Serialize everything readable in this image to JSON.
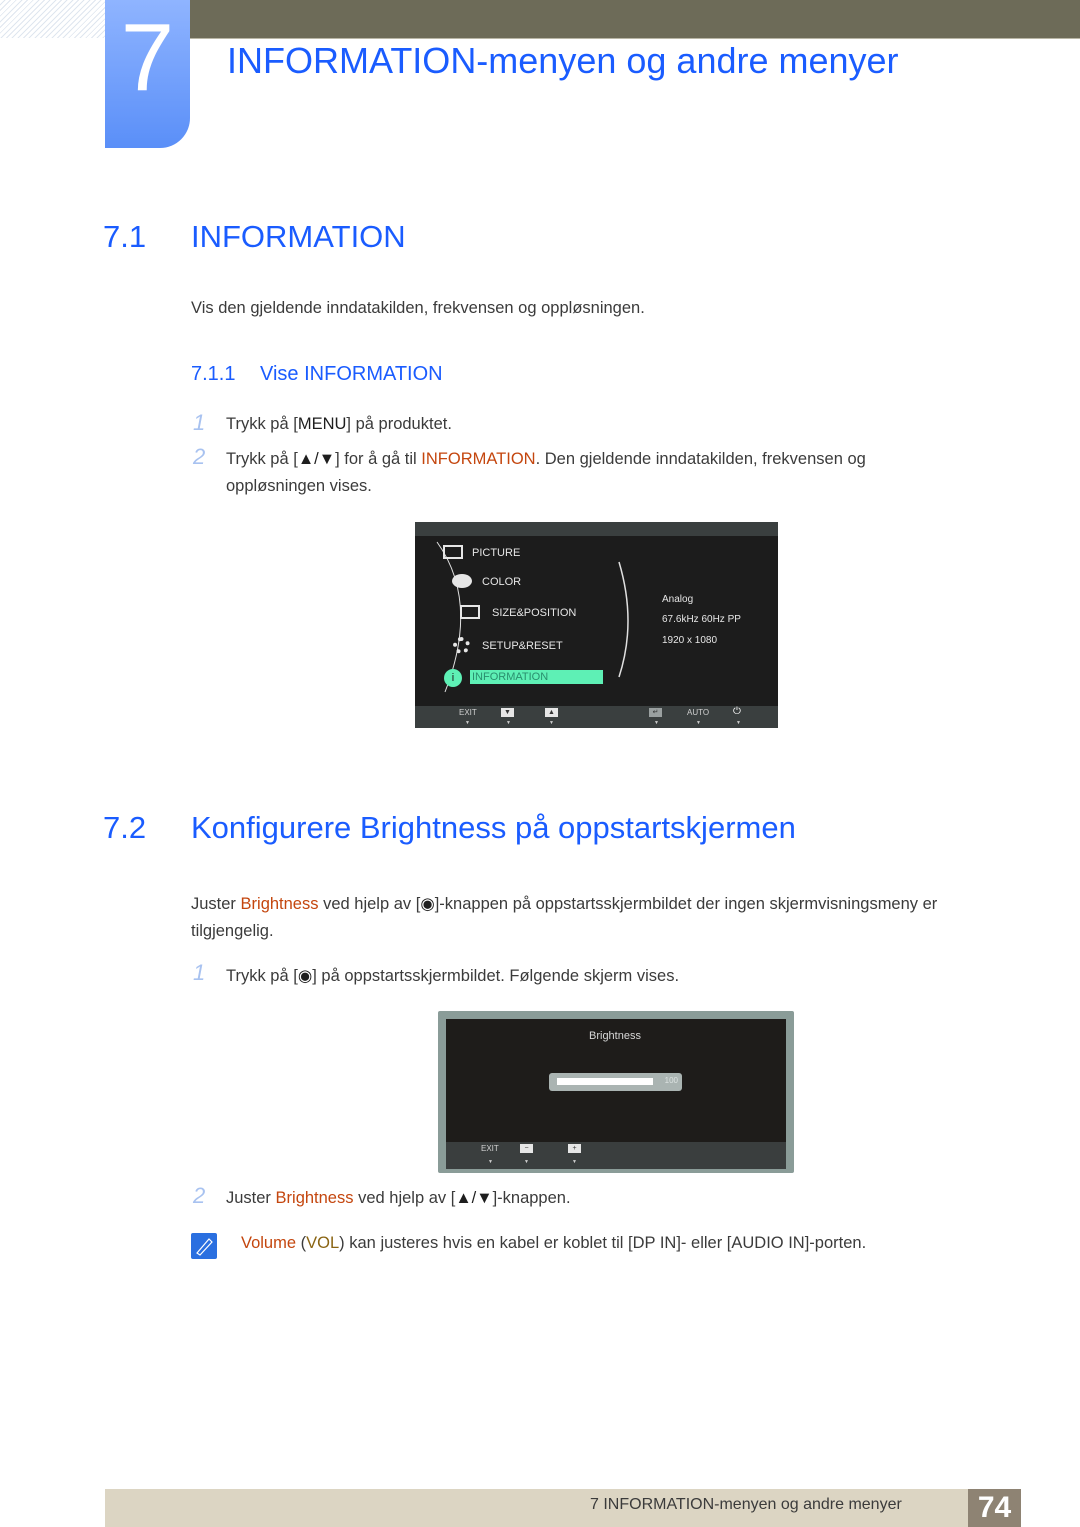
{
  "chapter": {
    "number": "7",
    "title": "INFORMATION-menyen og andre menyer"
  },
  "section_7_1": {
    "number": "7.1",
    "title": "INFORMATION",
    "intro": "Vis den gjeldende inndatakilden, frekvensen og oppløsningen.",
    "subsection": {
      "number": "7.1.1",
      "title": "Vise INFORMATION"
    },
    "steps": [
      {
        "num": "1",
        "pre": "Trykk på [",
        "key": "MENU",
        "post": "] på produktet."
      },
      {
        "num": "2",
        "pre": "Trykk på [",
        "key": "▲/▼",
        "mid": "] for å gå til ",
        "highlight": "INFORMATION",
        "post": ". Den gjeldende inndatakilden, frekvensen og",
        "line2": "oppløsningen vises."
      }
    ]
  },
  "osd_menu": {
    "items": [
      {
        "label": "PICTURE",
        "icon": "picture-icon"
      },
      {
        "label": "COLOR",
        "icon": "palette-icon"
      },
      {
        "label": "SIZE&POSITION",
        "icon": "size-position-icon"
      },
      {
        "label": "SETUP&RESET",
        "icon": "gear-icon"
      },
      {
        "label": "INFORMATION",
        "icon": "info-icon",
        "selected": true
      }
    ],
    "info": {
      "source": "Analog",
      "frequency": "67.6kHz 60Hz PP",
      "resolution": "1920 x 1080"
    },
    "footer": {
      "exit": "EXIT",
      "down": "▼",
      "up": "▲",
      "enter": "↵",
      "auto": "AUTO",
      "power": "⏻"
    },
    "highlight_color": "#5ef0b5"
  },
  "section_7_2": {
    "number": "7.2",
    "title": "Konfigurere Brightness på oppstartskjermen",
    "intro_pre": "Juster ",
    "intro_highlight": "Brightness",
    "intro_mid": " ved hjelp av [",
    "intro_key": "◉",
    "intro_post": "]-knappen på oppstartsskjermbildet der ingen skjermvisningsmeny er",
    "intro_line2": "tilgjengelig.",
    "steps": [
      {
        "num": "1",
        "pre": "Trykk på [",
        "key": "◉",
        "post": "] på oppstartsskjermbildet. Følgende skjerm vises."
      },
      {
        "num": "2",
        "pre": "Juster ",
        "highlight": "Brightness",
        "mid": " ved hjelp av [",
        "key": "▲/▼",
        "post": "]-knappen."
      }
    ],
    "note": {
      "highlight": "Volume",
      "paren_open": " (",
      "highlight2": "VOL",
      "text": ") kan justeres hvis en kabel er koblet til [DP IN]- eller [AUDIO IN]-porten."
    }
  },
  "osd_brightness": {
    "title": "Brightness",
    "value": "100",
    "level_percent": 100,
    "footer": {
      "exit": "EXIT",
      "minus": "−",
      "plus": "+"
    }
  },
  "page_footer": {
    "text": "7 INFORMATION-menyen og andre menyer",
    "page": "74"
  }
}
